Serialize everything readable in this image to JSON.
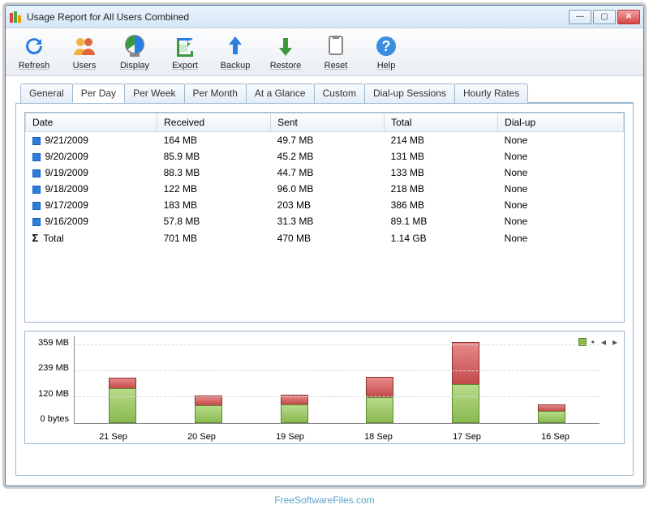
{
  "window": {
    "title": "Usage Report for All Users Combined"
  },
  "toolbar": [
    {
      "name": "refresh-button",
      "label": "Refresh",
      "icon": "refresh"
    },
    {
      "name": "users-button",
      "label": "Users",
      "icon": "users"
    },
    {
      "name": "display-button",
      "label": "Display",
      "icon": "display"
    },
    {
      "name": "export-button",
      "label": "Export",
      "icon": "export"
    },
    {
      "name": "backup-button",
      "label": "Backup",
      "icon": "backup"
    },
    {
      "name": "restore-button",
      "label": "Restore",
      "icon": "restore"
    },
    {
      "name": "reset-button",
      "label": "Reset",
      "icon": "reset"
    },
    {
      "name": "help-button",
      "label": "Help",
      "icon": "help"
    }
  ],
  "tabs": [
    {
      "name": "tab-general",
      "label": "General",
      "active": false
    },
    {
      "name": "tab-per-day",
      "label": "Per Day",
      "active": true
    },
    {
      "name": "tab-per-week",
      "label": "Per Week",
      "active": false
    },
    {
      "name": "tab-per-month",
      "label": "Per Month",
      "active": false
    },
    {
      "name": "tab-at-a-glance",
      "label": "At a Glance",
      "active": false
    },
    {
      "name": "tab-custom",
      "label": "Custom",
      "active": false
    },
    {
      "name": "tab-dialup",
      "label": "Dial-up Sessions",
      "active": false
    },
    {
      "name": "tab-hourly",
      "label": "Hourly Rates",
      "active": false
    }
  ],
  "table": {
    "headers": [
      "Date",
      "Received",
      "Sent",
      "Total",
      "Dial-up"
    ],
    "rows": [
      {
        "date": "9/21/2009",
        "received": "164 MB",
        "sent": "49.7 MB",
        "total": "214 MB",
        "dialup": "None"
      },
      {
        "date": "9/20/2009",
        "received": "85.9 MB",
        "sent": "45.2 MB",
        "total": "131 MB",
        "dialup": "None"
      },
      {
        "date": "9/19/2009",
        "received": "88.3 MB",
        "sent": "44.7 MB",
        "total": "133 MB",
        "dialup": "None"
      },
      {
        "date": "9/18/2009",
        "received": "122 MB",
        "sent": "96.0 MB",
        "total": "218 MB",
        "dialup": "None"
      },
      {
        "date": "9/17/2009",
        "received": "183 MB",
        "sent": "203 MB",
        "total": "386 MB",
        "dialup": "None"
      },
      {
        "date": "9/16/2009",
        "received": "57.8 MB",
        "sent": "31.3 MB",
        "total": "89.1 MB",
        "dialup": "None"
      }
    ],
    "total_row": {
      "label": "Total",
      "received": "701 MB",
      "sent": "470 MB",
      "total": "1.14 GB",
      "dialup": "None"
    }
  },
  "chart_data": {
    "type": "bar",
    "categories": [
      "21 Sep",
      "20 Sep",
      "19 Sep",
      "18 Sep",
      "17 Sep",
      "16 Sep"
    ],
    "series": [
      {
        "name": "Received",
        "values": [
          164,
          85.9,
          88.3,
          122,
          183,
          57.8
        ],
        "color": "#8ab94f"
      },
      {
        "name": "Sent",
        "values": [
          49.7,
          45.2,
          44.7,
          96.0,
          203,
          31.3
        ],
        "color": "#c34a4a"
      }
    ],
    "yticks": [
      "359 MB",
      "239 MB",
      "120 MB",
      "0 bytes"
    ],
    "ymax": 400,
    "ylabel": "",
    "xlabel": "",
    "title": ""
  },
  "footer": "FreeSoftwareFiles.com"
}
